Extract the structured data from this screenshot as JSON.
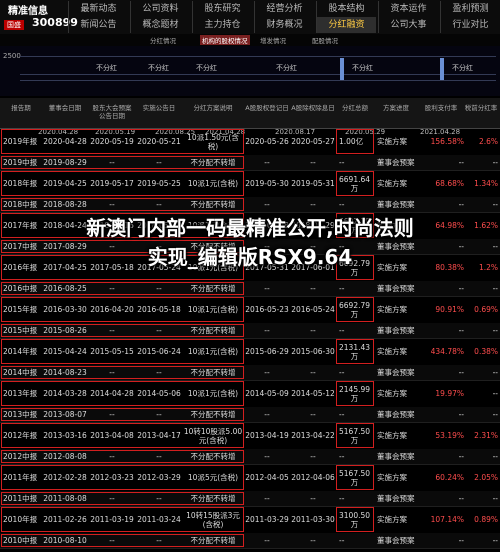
{
  "brand": {
    "title": "精准信息",
    "tag": "国盛",
    "code": "300899"
  },
  "nav": {
    "row1": [
      {
        "label": "最新动态"
      },
      {
        "label": "公司资料"
      },
      {
        "label": "股东研究"
      },
      {
        "label": "经营分析"
      },
      {
        "label": "股本结构"
      },
      {
        "label": "资本运作"
      },
      {
        "label": "盈利预测"
      }
    ],
    "row2": [
      {
        "label": "新闻公告"
      },
      {
        "label": "概念题材"
      },
      {
        "label": "主力持仓"
      },
      {
        "label": "财务概况"
      },
      {
        "label": "分红融资",
        "active": true
      },
      {
        "label": "公司大事"
      },
      {
        "label": "行业对比"
      }
    ]
  },
  "subtabs": [
    {
      "label": "分红情况"
    },
    {
      "label": "机构的股权情况",
      "active": true
    },
    {
      "label": "增发情况"
    },
    {
      "label": "配股情况"
    }
  ],
  "timeline": {
    "ytick": "2500",
    "labels": [
      "不分红",
      "不分红",
      "不分红",
      "不分红",
      "不分红",
      "不分红"
    ],
    "dates": [
      "2020.04.28",
      "2020.05.19",
      "2020.08.25",
      "2021.04.28",
      "2020.08.17",
      "2020.05.29",
      "2021.04.28"
    ]
  },
  "table": {
    "headers": [
      "报告期",
      "董事会日期",
      "股东大会预案\n公告日期",
      "实施公告日",
      "分红方案说明",
      "A股股权登记日",
      "A股除权除息日",
      "分红总额",
      "方案进度",
      "股利支付率",
      "税前分红率"
    ],
    "rows": [
      [
        "2019年报",
        "2020-04-28",
        "2020-05-19",
        "2020-05-21",
        "10派1.50元(含税)",
        "2020-05-26",
        "2020-05-27",
        "1.00亿",
        "实施方案",
        "156.58%",
        "2.6%"
      ],
      [
        "2019中报",
        "2019-08-29",
        "--",
        "--",
        "不分配不转增",
        "--",
        "--",
        "--",
        "董事会预案",
        "--",
        "--"
      ],
      [
        "2018年报",
        "2019-04-25",
        "2019-05-17",
        "2019-05-25",
        "10派1元(含税)",
        "2019-05-30",
        "2019-05-31",
        "6691.64\n万",
        "实施方案",
        "68.68%",
        "1.34%"
      ],
      [
        "2018中报",
        "2018-08-28",
        "--",
        "--",
        "不分配不转增",
        "--",
        "--",
        "--",
        "董事会预案",
        "--",
        "--"
      ],
      [
        "2017年报",
        "2018-04-24",
        "2018-05-16",
        "2018-05-22",
        "10派1元(含税)",
        "2018-05-28",
        "2018-05-29",
        "6692.79\n万",
        "实施方案",
        "64.98%",
        "1.62%"
      ],
      [
        "2017中报",
        "2017-08-29",
        "--",
        "--",
        "不分配不转增",
        "--",
        "--",
        "--",
        "董事会预案",
        "--",
        "--"
      ],
      [
        "2016年报",
        "2017-04-25",
        "2017-05-18",
        "2017-05-24",
        "10派1元(含税)",
        "2017-05-31",
        "2017-06-01",
        "6692.79\n万",
        "实施方案",
        "80.38%",
        "1.2%"
      ],
      [
        "2016中报",
        "2016-08-25",
        "--",
        "--",
        "不分配不转增",
        "--",
        "--",
        "--",
        "董事会预案",
        "--",
        "--"
      ],
      [
        "2015年报",
        "2016-03-30",
        "2016-04-20",
        "2016-05-18",
        "10派1元(含税)",
        "2016-05-23",
        "2016-05-24",
        "6692.79\n万",
        "实施方案",
        "90.91%",
        "0.69%"
      ],
      [
        "2015中报",
        "2015-08-26",
        "--",
        "--",
        "不分配不转增",
        "--",
        "--",
        "--",
        "董事会预案",
        "--",
        "--"
      ],
      [
        "2014年报",
        "2015-04-24",
        "2015-05-15",
        "2015-06-24",
        "10派1元(含税)",
        "2015-06-29",
        "2015-06-30",
        "2131.43\n万",
        "实施方案",
        "434.78%",
        "0.38%"
      ],
      [
        "2014中报",
        "2014-08-23",
        "--",
        "--",
        "不分配不转增",
        "--",
        "--",
        "--",
        "董事会预案",
        "--",
        "--"
      ],
      [
        "2013年报",
        "2014-03-28",
        "2014-04-28",
        "2014-05-06",
        "10派1元(含税)",
        "2014-05-09",
        "2014-05-12",
        "2145.99\n万",
        "实施方案",
        "19.97%",
        "--"
      ],
      [
        "2013中报",
        "2013-08-07",
        "--",
        "--",
        "不分配不转增",
        "--",
        "--",
        "--",
        "董事会预案",
        "--",
        "--"
      ],
      [
        "2012年报",
        "2013-03-16",
        "2013-04-08",
        "2013-04-17",
        "10转10股派5.00\n元(含税)",
        "2013-04-19",
        "2013-04-22",
        "5167.50\n万",
        "实施方案",
        "53.19%",
        "2.31%"
      ],
      [
        "2012中报",
        "2012-08-08",
        "--",
        "--",
        "不分配不转增",
        "--",
        "--",
        "--",
        "董事会预案",
        "--",
        "--"
      ],
      [
        "2011年报",
        "2012-02-28",
        "2012-03-23",
        "2012-03-29",
        "10派5元(含税)",
        "2012-04-05",
        "2012-04-06",
        "5167.50\n万",
        "实施方案",
        "60.24%",
        "2.05%"
      ],
      [
        "2011中报",
        "2011-08-08",
        "--",
        "--",
        "不分配不转增",
        "--",
        "--",
        "--",
        "董事会预案",
        "--",
        "--"
      ],
      [
        "2010年报",
        "2011-02-26",
        "2011-03-19",
        "2011-03-24",
        "10转15股派3元\n(含税)",
        "2011-03-29",
        "2011-03-30",
        "3100.50\n万",
        "实施方案",
        "107.14%",
        "0.89%"
      ],
      [
        "2010中报",
        "2010-08-10",
        "--",
        "--",
        "不分配不转增",
        "--",
        "--",
        "--",
        "董事会预案",
        "--",
        "--"
      ]
    ]
  },
  "overlay": {
    "line1": "新澳门内部一码最精准公开,时尚法则",
    "line2": "实现_编辑版RSX9.64"
  },
  "colors": {
    "highlight_box": "#d21f1f",
    "active_tab": "#ffcc44",
    "subtab_active": "#7a2020"
  }
}
